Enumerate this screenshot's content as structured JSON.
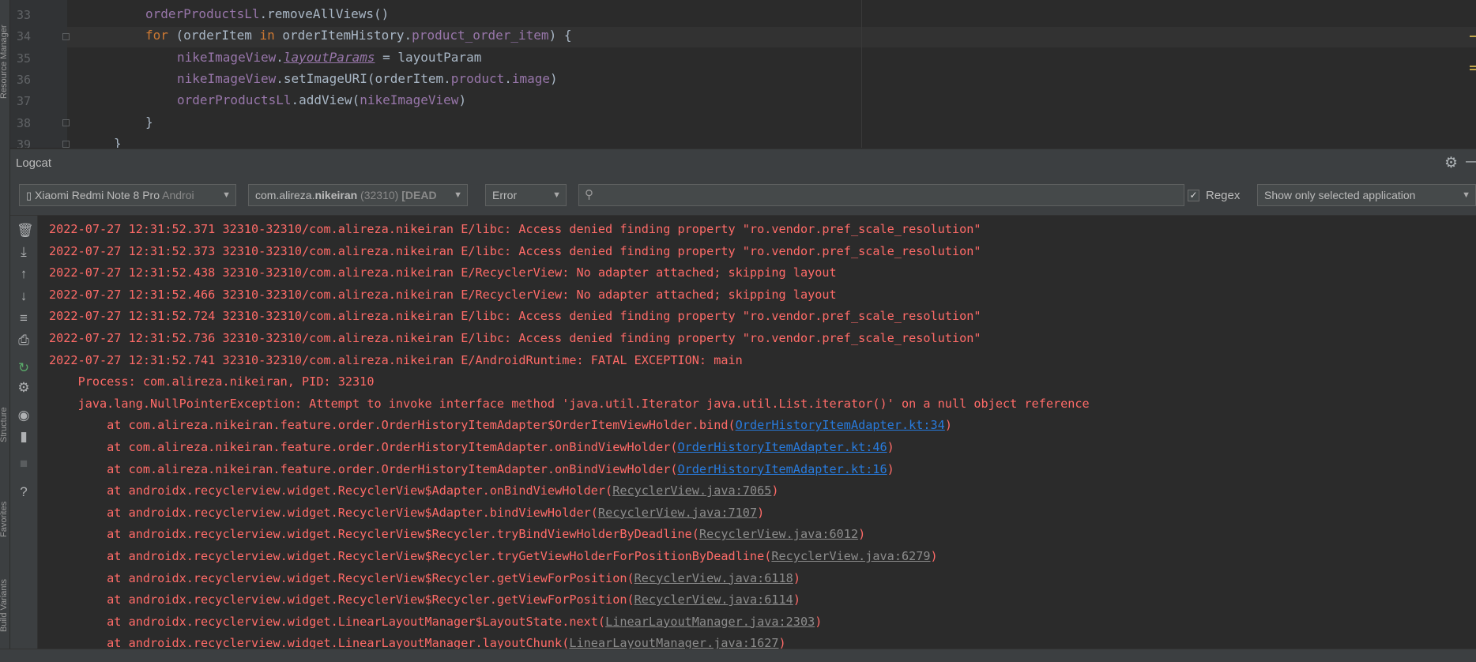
{
  "left_strip": {
    "tab_top": "Resource Manager",
    "tab_structure": "Structure",
    "tab_favorites": "Favorites",
    "tab_build_variants": "Build Variants"
  },
  "editor": {
    "lines": [
      {
        "num": "33",
        "segments": [
          {
            "t": "orderProductsLl",
            "c": "v"
          },
          {
            "t": ".removeAllViews()",
            "c": "n"
          }
        ]
      },
      {
        "num": "34",
        "segments": [
          {
            "t": "for ",
            "c": "k"
          },
          {
            "t": "(orderItem ",
            "c": "n"
          },
          {
            "t": "in ",
            "c": "k"
          },
          {
            "t": "orderItemHistory.",
            "c": "n"
          },
          {
            "t": "product_order_item",
            "c": "v"
          },
          {
            "t": ") {",
            "c": "n"
          }
        ]
      },
      {
        "num": "35",
        "segments": [
          {
            "t": "nikeImageView",
            "c": "v"
          },
          {
            "t": ".",
            "c": "n"
          },
          {
            "t": "layoutParams",
            "c": "vi"
          },
          {
            "t": " = layoutParam",
            "c": "n"
          }
        ]
      },
      {
        "num": "36",
        "segments": [
          {
            "t": "nikeImageView",
            "c": "v"
          },
          {
            "t": ".setImageURI(orderItem.",
            "c": "n"
          },
          {
            "t": "product",
            "c": "v"
          },
          {
            "t": ".",
            "c": "n"
          },
          {
            "t": "image",
            "c": "v"
          },
          {
            "t": ")",
            "c": "n"
          }
        ]
      },
      {
        "num": "37",
        "segments": [
          {
            "t": "orderProductsLl",
            "c": "v"
          },
          {
            "t": ".addView(",
            "c": "n"
          },
          {
            "t": "nikeImageView",
            "c": "v"
          },
          {
            "t": ")",
            "c": "n"
          }
        ]
      },
      {
        "num": "38",
        "segments": [
          {
            "t": "}",
            "c": "n"
          }
        ]
      },
      {
        "num": "39",
        "segments": [
          {
            "t": "}",
            "c": "n"
          }
        ]
      }
    ]
  },
  "logcat": {
    "title": "Logcat",
    "device": {
      "name": "Xiaomi Redmi Note 8 Pro",
      "suffix": "Androi"
    },
    "process": {
      "prefix": "com.alireza.",
      "bold": "nikeiran",
      "pid": " (32310)",
      "state": " [DEAD"
    },
    "level": "Error",
    "search_placeholder": "",
    "regex_checked": "✓",
    "regex_label": "Regex",
    "filter": "Show only selected application",
    "lines": [
      {
        "pre": "2022-07-27 12:31:52.371 32310-32310/com.alireza.nikeiran E/libc: Access denied finding property \"ro.vendor.pref_scale_resolution\"",
        "link": "",
        "post": "",
        "gray": false
      },
      {
        "pre": "2022-07-27 12:31:52.373 32310-32310/com.alireza.nikeiran E/libc: Access denied finding property \"ro.vendor.pref_scale_resolution\"",
        "link": "",
        "post": "",
        "gray": false
      },
      {
        "pre": "2022-07-27 12:31:52.438 32310-32310/com.alireza.nikeiran E/RecyclerView: No adapter attached; skipping layout",
        "link": "",
        "post": "",
        "gray": false
      },
      {
        "pre": "2022-07-27 12:31:52.466 32310-32310/com.alireza.nikeiran E/RecyclerView: No adapter attached; skipping layout",
        "link": "",
        "post": "",
        "gray": false
      },
      {
        "pre": "2022-07-27 12:31:52.724 32310-32310/com.alireza.nikeiran E/libc: Access denied finding property \"ro.vendor.pref_scale_resolution\"",
        "link": "",
        "post": "",
        "gray": false
      },
      {
        "pre": "2022-07-27 12:31:52.736 32310-32310/com.alireza.nikeiran E/libc: Access denied finding property \"ro.vendor.pref_scale_resolution\"",
        "link": "",
        "post": "",
        "gray": false
      },
      {
        "pre": "2022-07-27 12:31:52.741 32310-32310/com.alireza.nikeiran E/AndroidRuntime: FATAL EXCEPTION: main",
        "link": "",
        "post": "",
        "gray": false
      },
      {
        "pre": "    Process: com.alireza.nikeiran, PID: 32310",
        "link": "",
        "post": "",
        "gray": false
      },
      {
        "pre": "    java.lang.NullPointerException: Attempt to invoke interface method 'java.util.Iterator java.util.List.iterator()' on a null object reference",
        "link": "",
        "post": "",
        "gray": false
      },
      {
        "pre": "        at com.alireza.nikeiran.feature.order.OrderHistoryItemAdapter$OrderItemViewHolder.bind(",
        "link": "OrderHistoryItemAdapter.kt:34",
        "post": ")",
        "gray": false
      },
      {
        "pre": "        at com.alireza.nikeiran.feature.order.OrderHistoryItemAdapter.onBindViewHolder(",
        "link": "OrderHistoryItemAdapter.kt:46",
        "post": ")",
        "gray": false
      },
      {
        "pre": "        at com.alireza.nikeiran.feature.order.OrderHistoryItemAdapter.onBindViewHolder(",
        "link": "OrderHistoryItemAdapter.kt:16",
        "post": ")",
        "gray": false
      },
      {
        "pre": "        at androidx.recyclerview.widget.RecyclerView$Adapter.onBindViewHolder(",
        "link": "RecyclerView.java:7065",
        "post": ")",
        "gray": true
      },
      {
        "pre": "        at androidx.recyclerview.widget.RecyclerView$Adapter.bindViewHolder(",
        "link": "RecyclerView.java:7107",
        "post": ")",
        "gray": true
      },
      {
        "pre": "        at androidx.recyclerview.widget.RecyclerView$Recycler.tryBindViewHolderByDeadline(",
        "link": "RecyclerView.java:6012",
        "post": ")",
        "gray": true
      },
      {
        "pre": "        at androidx.recyclerview.widget.RecyclerView$Recycler.tryGetViewHolderForPositionByDeadline(",
        "link": "RecyclerView.java:6279",
        "post": ")",
        "gray": true
      },
      {
        "pre": "        at androidx.recyclerview.widget.RecyclerView$Recycler.getViewForPosition(",
        "link": "RecyclerView.java:6118",
        "post": ")",
        "gray": true
      },
      {
        "pre": "        at androidx.recyclerview.widget.RecyclerView$Recycler.getViewForPosition(",
        "link": "RecyclerView.java:6114",
        "post": ")",
        "gray": true
      },
      {
        "pre": "        at androidx.recyclerview.widget.LinearLayoutManager$LayoutState.next(",
        "link": "LinearLayoutManager.java:2303",
        "post": ")",
        "gray": true
      },
      {
        "pre": "        at androidx.recyclerview.widget.LinearLayoutManager.layoutChunk(",
        "link": "LinearLayoutManager.java:1627",
        "post": ")",
        "gray": true
      }
    ]
  },
  "colors": {
    "background": "#2b2b2b",
    "panel": "#3c3f41",
    "error_text": "#ff6b68",
    "link": "#287bde",
    "library_link": "#8c8c8c",
    "keyword": "#cc7832",
    "field": "#9876aa"
  },
  "icons": {
    "logcat_toolbar": [
      "trash-icon",
      "scroll-to-end-icon",
      "up-arrow-icon",
      "down-arrow-icon",
      "soft-wrap-icon",
      "print-icon",
      "restart-icon",
      "settings-icon",
      "camera-icon",
      "video-icon",
      "stop-icon",
      "help-icon"
    ]
  }
}
